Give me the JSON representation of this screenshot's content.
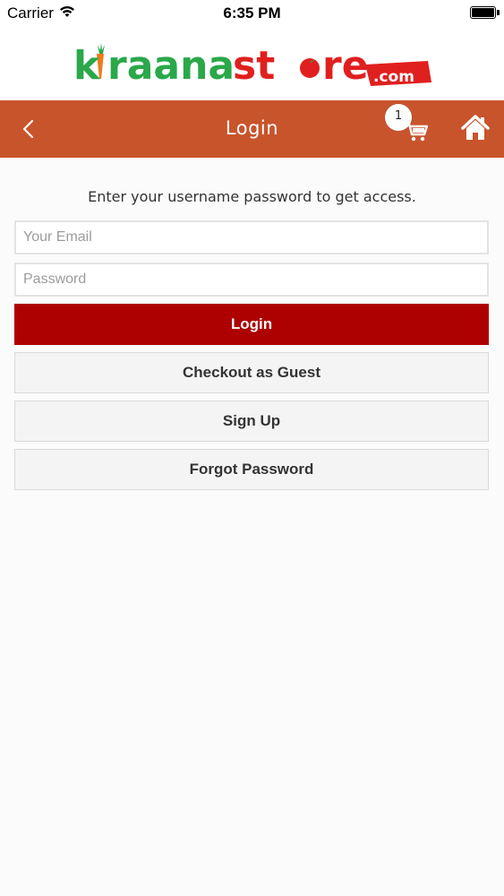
{
  "status_bar": {
    "carrier": "Carrier",
    "time": "6:35 PM",
    "icons": [
      "wifi-icon",
      "battery-icon"
    ]
  },
  "logo": {
    "text": "kiraanastore",
    "suffix": ".com",
    "colors": {
      "green": "#2aa84a",
      "orange": "#f07a1a",
      "red": "#e0201f"
    }
  },
  "header": {
    "title": "Login",
    "cart_count": "1",
    "background": "#c8542c",
    "icons": [
      "chevron-left-icon",
      "cart-icon",
      "home-icon"
    ]
  },
  "form": {
    "intro": "Enter your username password to get access.",
    "email_placeholder": "Your Email",
    "email_value": "",
    "password_placeholder": "Password",
    "password_value": ""
  },
  "buttons": {
    "login": "Login",
    "guest": "Checkout as Guest",
    "signup": "Sign Up",
    "forgot": "Forgot Password",
    "primary_color": "#ad0000"
  }
}
